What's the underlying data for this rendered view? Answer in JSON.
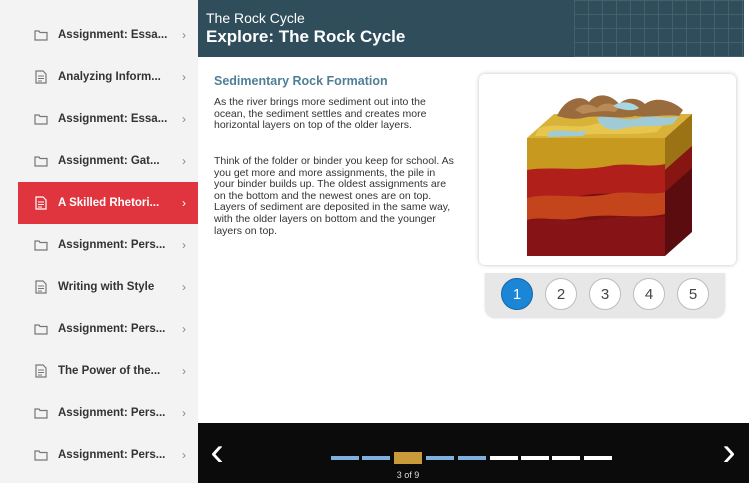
{
  "sidebar": {
    "items": [
      {
        "label": "Assignment: Essa...",
        "icon": "folder-icon",
        "active": false
      },
      {
        "label": "Analyzing Inform...",
        "icon": "document-icon",
        "active": false
      },
      {
        "label": "Assignment: Essa...",
        "icon": "folder-icon",
        "active": false
      },
      {
        "label": "Assignment: Gat...",
        "icon": "folder-icon",
        "active": false
      },
      {
        "label": "A Skilled Rhetori...",
        "icon": "document-icon",
        "active": true
      },
      {
        "label": "Assignment: Pers...",
        "icon": "folder-icon",
        "active": false
      },
      {
        "label": "Writing with Style",
        "icon": "document-icon",
        "active": false
      },
      {
        "label": "Assignment: Pers...",
        "icon": "folder-icon",
        "active": false
      },
      {
        "label": "The Power of the...",
        "icon": "document-icon",
        "active": false
      },
      {
        "label": "Assignment: Pers...",
        "icon": "folder-icon",
        "active": false
      },
      {
        "label": "Assignment: Pers...",
        "icon": "folder-icon",
        "active": false
      }
    ],
    "chevron": "›"
  },
  "header": {
    "course": "The Rock Cycle",
    "title": "Explore: The Rock Cycle"
  },
  "content": {
    "section_title": "Sedimentary Rock Formation",
    "paragraph1": "As the river brings more sediment out into the ocean, the sediment settles and creates more horizontal layers on top of the older layers.",
    "paragraph2": "Think of the folder or binder you keep for school. As you get more and more assignments, the pile in your binder builds up. The oldest assignments are on the bottom and the newest ones are on top. Layers of sediment are deposited in the same way, with the older layers on bottom and the younger layers on top.",
    "image_icon": "rock-layers-illustration"
  },
  "stepper": {
    "steps": [
      "1",
      "2",
      "3",
      "4",
      "5"
    ],
    "active": 0
  },
  "footer": {
    "prev": "‹",
    "next": "›",
    "progress": {
      "total": 9,
      "current": 3
    },
    "page_indicator": "3 of 9"
  },
  "colors": {
    "header_bg": "#2f4d5a",
    "active_item": "#e0353f",
    "section_title": "#4f7f95",
    "active_step": "#1b86d6",
    "progress_done": "#7fb0de",
    "progress_current": "#c89a3a"
  }
}
